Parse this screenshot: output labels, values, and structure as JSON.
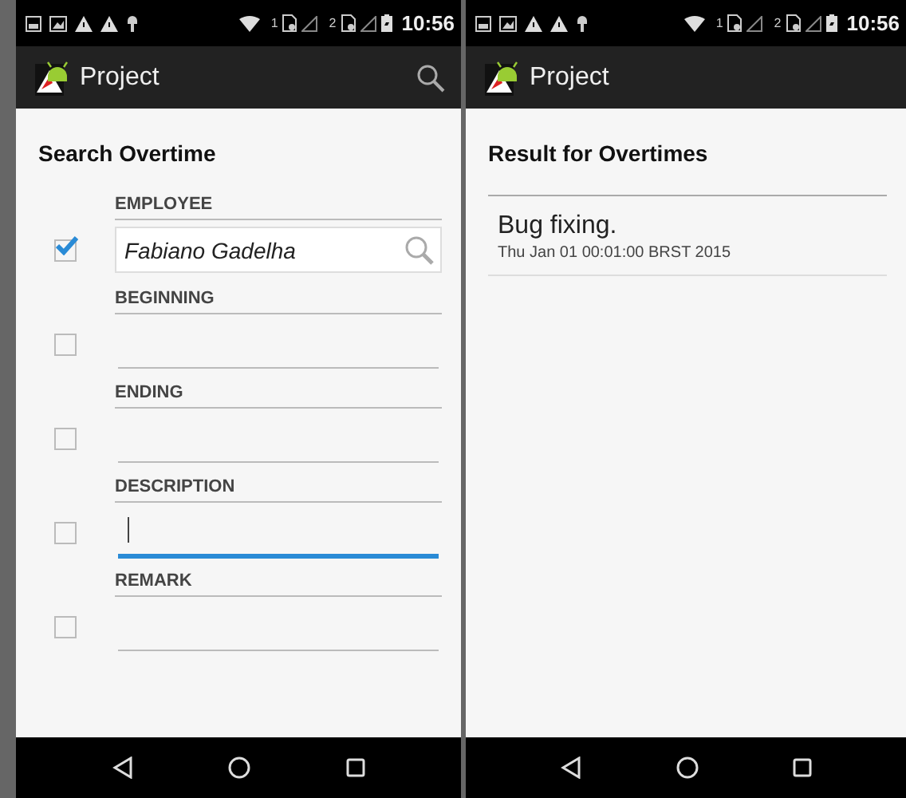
{
  "screens": [
    {
      "kind": "search_form",
      "status_bar": {
        "sim_1": "1",
        "sim_2": "2",
        "time": "10:56"
      },
      "action_bar": {
        "title": "Project",
        "actions": [
          {
            "kind": "search"
          }
        ]
      },
      "heading": "Search Overtime",
      "fields": [
        {
          "kind": "lookup",
          "label": "EMPLOYEE",
          "checked": true,
          "value": "Fabiano Gadelha"
        },
        {
          "kind": "text",
          "label": "BEGINNING",
          "checked": false,
          "focused": false
        },
        {
          "kind": "text",
          "label": "ENDING",
          "checked": false,
          "focused": false
        },
        {
          "kind": "text",
          "label": "DESCRIPTION",
          "checked": false,
          "focused": true
        },
        {
          "kind": "text",
          "label": "REMARK",
          "checked": false,
          "focused": false
        }
      ]
    },
    {
      "kind": "results",
      "status_bar": {
        "sim_1": "1",
        "sim_2": "2",
        "time": "10:56"
      },
      "action_bar": {
        "title": "Project"
      },
      "heading": "Result for Overtimes",
      "results": [
        {
          "title": "Bug fixing.",
          "subtitle": "Thu Jan 01 00:01:00 BRST 2015"
        }
      ]
    }
  ]
}
